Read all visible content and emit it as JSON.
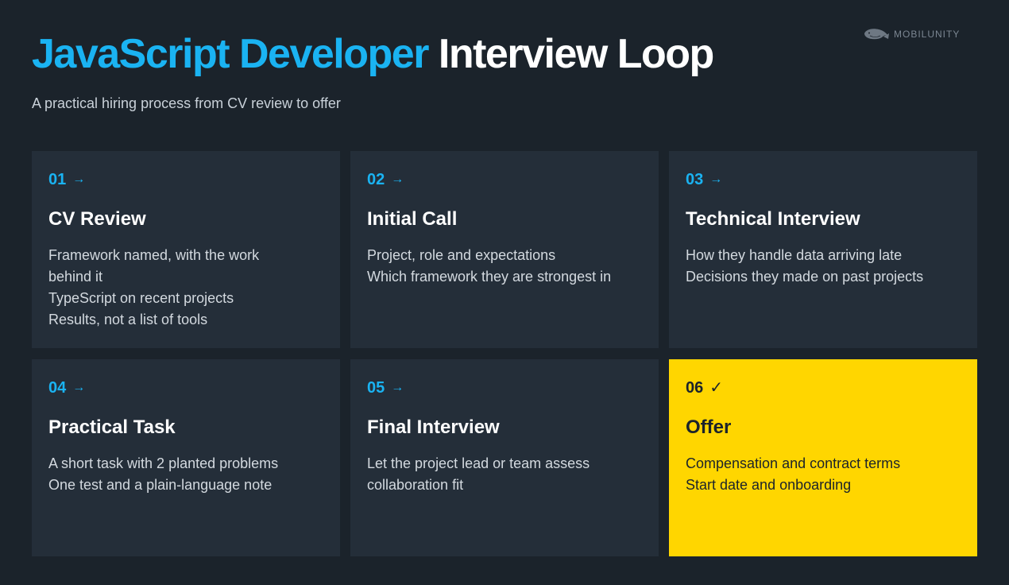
{
  "header": {
    "title_accent": "JavaScript Developer",
    "title_rest": "Interview Loop",
    "subtitle": "A practical hiring process from CV review to offer",
    "logo_text": "MOBILUNITY",
    "logo_icon": "whale-icon"
  },
  "colors": {
    "background": "#1b232b",
    "card": "#242e39",
    "accent": "#1ab3f2",
    "highlight": "#ffd600"
  },
  "steps": [
    {
      "number": "01",
      "icon": "→",
      "title": "CV Review",
      "lines": [
        "Framework named, with the work behind it",
        "TypeScript on recent projects",
        "Results, not a list of tools"
      ]
    },
    {
      "number": "02",
      "icon": "→",
      "title": "Initial Call",
      "lines": [
        "Project, role and expectations",
        "Which framework they are strongest in"
      ]
    },
    {
      "number": "03",
      "icon": "→",
      "title": "Technical Interview",
      "lines": [
        "How they handle data arriving late",
        "Decisions they made on past projects"
      ]
    },
    {
      "number": "04",
      "icon": "→",
      "title": "Practical Task",
      "lines": [
        "A short task with 2 planted problems",
        "One test and a plain-language note"
      ]
    },
    {
      "number": "05",
      "icon": "→",
      "title": "Final Interview",
      "lines": [
        "Let the project lead or team assess collaboration fit"
      ]
    },
    {
      "number": "06",
      "icon": "✓",
      "title": "Offer",
      "lines": [
        "Compensation and contract terms",
        "Start date and onboarding"
      ]
    }
  ]
}
